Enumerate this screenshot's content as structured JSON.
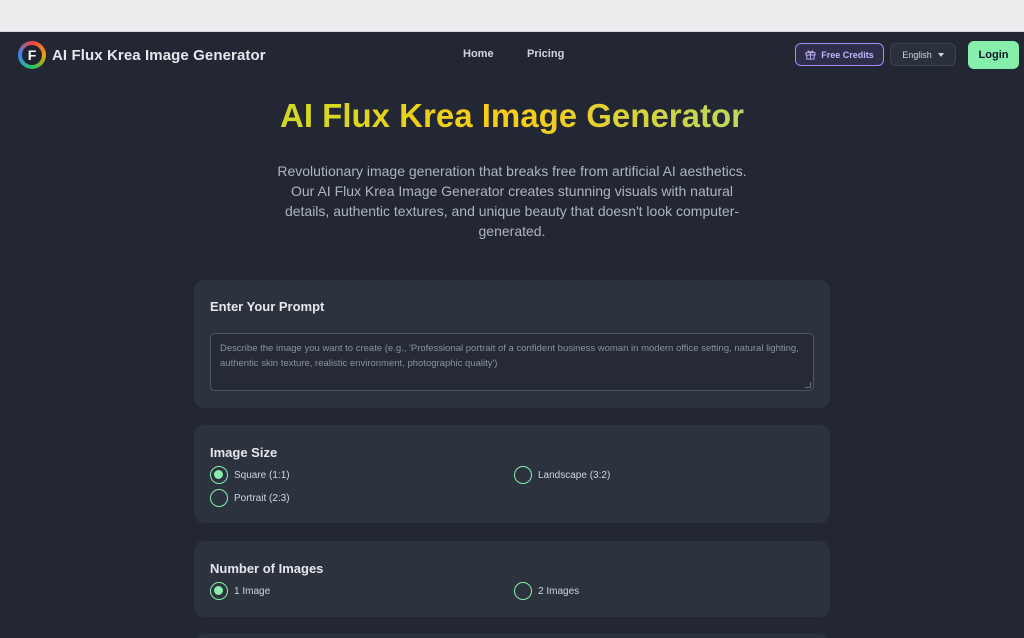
{
  "header": {
    "brand_logo_letter": "F",
    "brand_name": "AI Flux Krea Image Generator",
    "nav": [
      {
        "label": "Home"
      },
      {
        "label": "Pricing"
      }
    ],
    "free_credits_label": "Free Credits",
    "language_label": "English",
    "login_label": "Login"
  },
  "hero": {
    "title": "AI Flux Krea Image Generator",
    "description": "Revolutionary image generation that breaks free from artificial AI aesthetics. Our AI Flux Krea Image Generator creates stunning visuals with natural details, authentic textures, and unique beauty that doesn't look computer-generated."
  },
  "prompt_card": {
    "title": "Enter Your Prompt",
    "placeholder": "Describe the image you want to create (e.g., 'Professional portrait of a confident business woman in modern office setting, natural lighting, authentic skin texture, realistic environment, photographic quality')"
  },
  "size_card": {
    "title": "Image Size",
    "options": [
      {
        "label": "Square (1:1)",
        "selected": true
      },
      {
        "label": "Landscape (3:2)",
        "selected": false
      },
      {
        "label": "Portrait (2:3)",
        "selected": false
      }
    ]
  },
  "count_card": {
    "title": "Number of Images",
    "options": [
      {
        "label": "1 Image",
        "selected": true
      },
      {
        "label": "2 Images",
        "selected": false
      }
    ]
  },
  "colors": {
    "accent_green": "#86efac",
    "accent_purple": "#a78bfa",
    "background": "#222733",
    "card": "#2c323e"
  }
}
